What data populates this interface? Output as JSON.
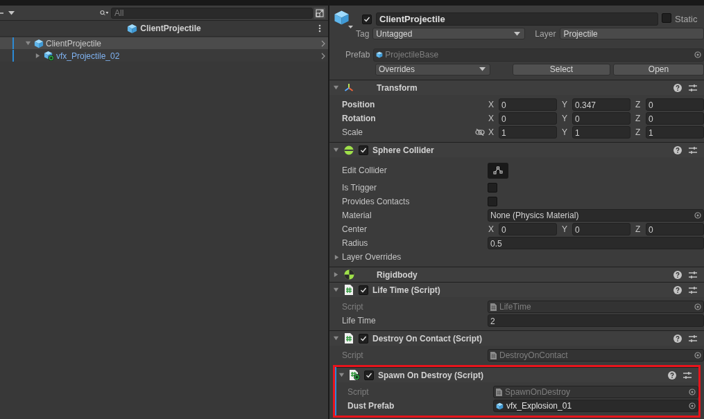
{
  "hierarchy": {
    "search": {
      "placeholder": "All"
    },
    "scene_title": "ClientProjectile",
    "tree": [
      {
        "label": "ClientProjectile",
        "kind": "prefab_root",
        "selected": true,
        "expanded": true,
        "children": [
          {
            "label": "vfx_Projectile_02",
            "kind": "added_prefab",
            "selected": false,
            "expanded": false
          }
        ]
      }
    ]
  },
  "inspector": {
    "object": {
      "active": true,
      "name": "ClientProjectile",
      "static": false,
      "static_label": "Static",
      "tag_label": "Tag",
      "tag": "Untagged",
      "layer_label": "Layer",
      "layer": "Projectile",
      "prefab_label": "Prefab",
      "prefab": "ProjectileBase",
      "overrides": "Overrides",
      "buttons": [
        "Select",
        "Open"
      ]
    },
    "components": [
      {
        "kind": "transform",
        "title": "Transform",
        "expanded": true,
        "fields": [
          {
            "kind": "vector3",
            "label": "Position",
            "overridden": true,
            "values": [
              {
                "axis": "X",
                "value": "0"
              },
              {
                "axis": "Y",
                "value": "0.347"
              },
              {
                "axis": "Z",
                "value": "0"
              }
            ]
          },
          {
            "kind": "vector3",
            "label": "Rotation",
            "overridden": true,
            "values": [
              {
                "axis": "X",
                "value": "0"
              },
              {
                "axis": "Y",
                "value": "0"
              },
              {
                "axis": "Z",
                "value": "0"
              }
            ]
          },
          {
            "kind": "vector3",
            "label": "Scale",
            "overridden": false,
            "constrained": false,
            "values": [
              {
                "axis": "X",
                "value": "1"
              },
              {
                "axis": "Y",
                "value": "1"
              },
              {
                "axis": "Z",
                "value": "1"
              }
            ]
          }
        ]
      },
      {
        "kind": "sphere_collider",
        "title": "Sphere Collider",
        "enabled": true,
        "expanded": true,
        "fields": [
          {
            "kind": "edit_button",
            "label": "Edit Collider"
          },
          {
            "kind": "checkbox",
            "label": "Is Trigger",
            "checked": false
          },
          {
            "kind": "checkbox",
            "label": "Provides Contacts",
            "checked": false
          },
          {
            "kind": "object",
            "label": "Material",
            "value": "None (Physics Material)"
          },
          {
            "kind": "vector3",
            "label": "Center",
            "overridden": false,
            "values": [
              {
                "axis": "X",
                "value": "0"
              },
              {
                "axis": "Y",
                "value": "0"
              },
              {
                "axis": "Z",
                "value": "0"
              }
            ]
          },
          {
            "kind": "float",
            "label": "Radius",
            "value": "0.5"
          },
          {
            "kind": "foldout",
            "label": "Layer Overrides",
            "expanded": false
          }
        ]
      },
      {
        "kind": "rigidbody",
        "title": "Rigidbody",
        "expanded": false
      },
      {
        "kind": "script",
        "title": "Life Time (Script)",
        "enabled": true,
        "expanded": true,
        "fields": [
          {
            "kind": "script",
            "label": "Script",
            "value": "LifeTime"
          },
          {
            "kind": "float",
            "label": "Life Time",
            "value": "2"
          }
        ]
      },
      {
        "kind": "script",
        "title": "Destroy On Contact (Script)",
        "enabled": true,
        "expanded": true,
        "fields": [
          {
            "kind": "script",
            "label": "Script",
            "value": "DestroyOnContact"
          }
        ]
      },
      {
        "kind": "added_script",
        "title": "Spawn On Destroy (Script)",
        "enabled": true,
        "expanded": true,
        "highlighted": true,
        "added": true,
        "fields": [
          {
            "kind": "script",
            "label": "Script",
            "value": "SpawnOnDestroy"
          },
          {
            "kind": "prefab_object",
            "label": "Dust Prefab",
            "overridden": true,
            "value": "vfx_Explosion_01"
          }
        ]
      }
    ]
  }
}
